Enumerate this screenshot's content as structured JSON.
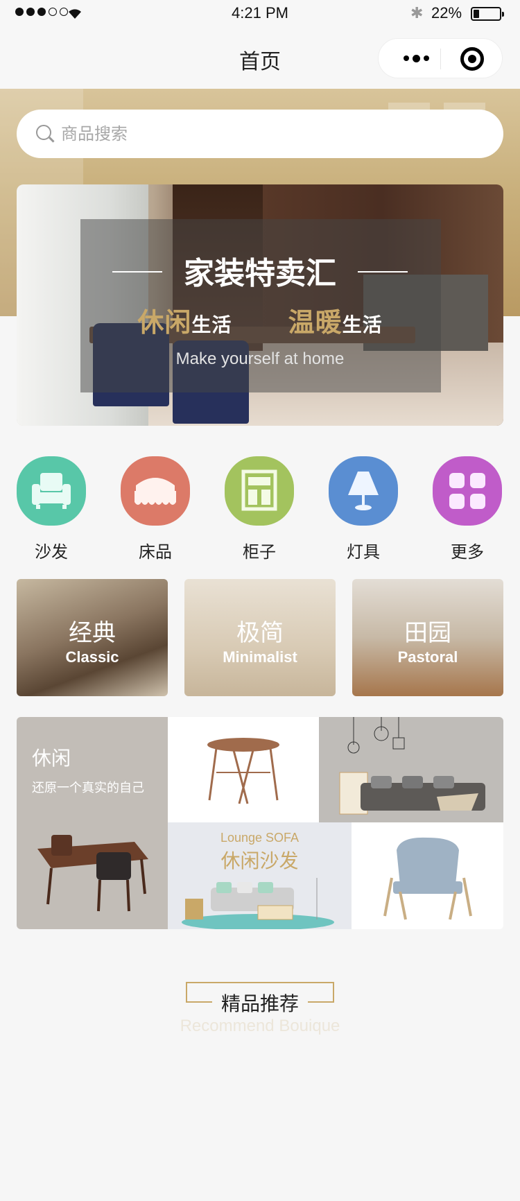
{
  "status_bar": {
    "time": "4:21 PM",
    "battery_percent": "22%",
    "battery_level": 0.22,
    "signal_bars_filled": 3,
    "signal_bars_total": 5,
    "bluetooth_icon": "bluetooth-icon",
    "wifi_icon": "wifi-icon"
  },
  "nav": {
    "title": "首页",
    "more_icon": "more-dots-icon",
    "close_icon": "target-circle-icon"
  },
  "search": {
    "placeholder": "商品搜索",
    "icon": "search-icon"
  },
  "banner": {
    "title": "家装特卖汇",
    "sub_a_highlight": "休闲",
    "sub_a_rest": "生活",
    "sub_b_highlight": "温暖",
    "sub_b_rest": "生活",
    "english": "Make yourself at home"
  },
  "categories": [
    {
      "label": "沙发",
      "icon": "sofa-icon",
      "color": "#58c7a8"
    },
    {
      "label": "床品",
      "icon": "bed-icon",
      "color": "#dc7a68"
    },
    {
      "label": "柜子",
      "icon": "cabinet-icon",
      "color": "#a3c35e"
    },
    {
      "label": "灯具",
      "icon": "lamp-icon",
      "color": "#5a8ed2"
    },
    {
      "label": "更多",
      "icon": "grid-icon",
      "color": "#c05cc9"
    }
  ],
  "styles": [
    {
      "cn": "经典",
      "en": "Classic"
    },
    {
      "cn": "极简",
      "en": "Minimalist"
    },
    {
      "cn": "田园",
      "en": "Pastoral"
    }
  ],
  "mosaic": {
    "leisure_title": "休闲",
    "leisure_sub": "还原一个真实的自己",
    "sofa_en": "Lounge SOFA",
    "sofa_cn": "休闲沙发"
  },
  "section": {
    "title": "精品推荐",
    "subtitle": "Recommend Bouique"
  },
  "colors": {
    "accent_gold": "#c9a868",
    "page_bg": "#f6f6f6"
  }
}
